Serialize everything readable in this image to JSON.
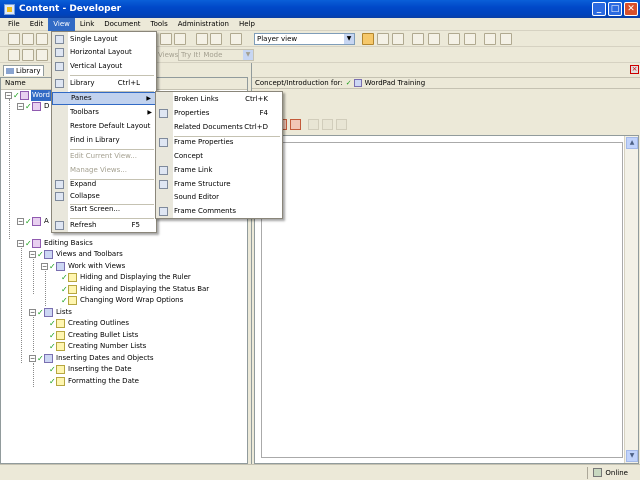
{
  "window": {
    "title": "Content - Developer",
    "controls": [
      "_",
      "□",
      "✕"
    ]
  },
  "menubar": [
    "File",
    "Edit",
    "View",
    "Link",
    "Document",
    "Tools",
    "Administration",
    "Help"
  ],
  "toolbar": {
    "view_combo": "Player view",
    "mode_label": "Views:",
    "mode_combo": "Try It! Mode"
  },
  "left_pane": {
    "tab_label": "Library",
    "column_header": "Name",
    "tree": [
      {
        "label": "Word",
        "level": 0,
        "type": "module",
        "expanded": true,
        "selected": true
      },
      {
        "label": "D",
        "level": 1,
        "type": "module"
      },
      {
        "label": "A",
        "level": 1,
        "type": "module"
      },
      {
        "label": "Editing Basics",
        "level": 1,
        "type": "module"
      },
      {
        "label": "Views and Toolbars",
        "level": 2,
        "type": "section"
      },
      {
        "label": "Work with Views",
        "level": 3,
        "type": "section"
      },
      {
        "label": "Hiding and Displaying the Ruler",
        "level": 4,
        "type": "topic"
      },
      {
        "label": "Hiding and Displaying the Status Bar",
        "level": 4,
        "type": "topic"
      },
      {
        "label": "Changing Word Wrap Options",
        "level": 4,
        "type": "topic"
      },
      {
        "label": "Lists",
        "level": 2,
        "type": "section"
      },
      {
        "label": "Creating Outlines",
        "level": 3,
        "type": "topic"
      },
      {
        "label": "Creating Bullet Lists",
        "level": 3,
        "type": "topic"
      },
      {
        "label": "Creating Number Lists",
        "level": 3,
        "type": "topic"
      },
      {
        "label": "Inserting Dates and Objects",
        "level": 2,
        "type": "section"
      },
      {
        "label": "Inserting the Date",
        "level": 3,
        "type": "topic"
      },
      {
        "label": "Formatting the Date",
        "level": 3,
        "type": "topic"
      }
    ]
  },
  "right_pane": {
    "concept_label": "Concept/Introduction for:",
    "concept_target": "WordPad Training"
  },
  "view_menu": {
    "items": [
      {
        "label": "Single Layout",
        "icon": "single-layout-icon"
      },
      {
        "label": "Horizontal Layout",
        "icon": "horizontal-layout-icon"
      },
      {
        "label": "Vertical Layout",
        "icon": "vertical-layout-icon"
      },
      {
        "label": "Library",
        "shortcut": "Ctrl+L",
        "icon": "library-icon"
      },
      {
        "label": "Panes",
        "submenu": true
      },
      {
        "label": "Toolbars",
        "submenu": true
      },
      {
        "label": "Restore Default Layout"
      },
      {
        "label": "Find in Library"
      },
      {
        "label": "Edit Current View...",
        "disabled": true
      },
      {
        "label": "Manage Views...",
        "disabled": true
      },
      {
        "label": "Expand",
        "icon": "expand-icon"
      },
      {
        "label": "Collapse",
        "icon": "collapse-icon"
      },
      {
        "label": "Start Screen..."
      },
      {
        "label": "Refresh",
        "shortcut": "F5",
        "icon": "refresh-icon"
      }
    ]
  },
  "panes_menu": {
    "items": [
      {
        "label": "Broken Links",
        "shortcut": "Ctrl+K"
      },
      {
        "label": "Properties",
        "shortcut": "F4",
        "icon": "properties-icon"
      },
      {
        "label": "Related Documents",
        "shortcut": "Ctrl+D"
      },
      {
        "label": "Frame Properties",
        "icon": "frame-properties-icon"
      },
      {
        "label": "Concept"
      },
      {
        "label": "Frame Link",
        "icon": "frame-link-icon"
      },
      {
        "label": "Frame Structure",
        "icon": "frame-structure-icon"
      },
      {
        "label": "Sound Editor"
      },
      {
        "label": "Frame Comments",
        "icon": "frame-comments-icon"
      }
    ]
  },
  "status": {
    "online": "Online"
  }
}
